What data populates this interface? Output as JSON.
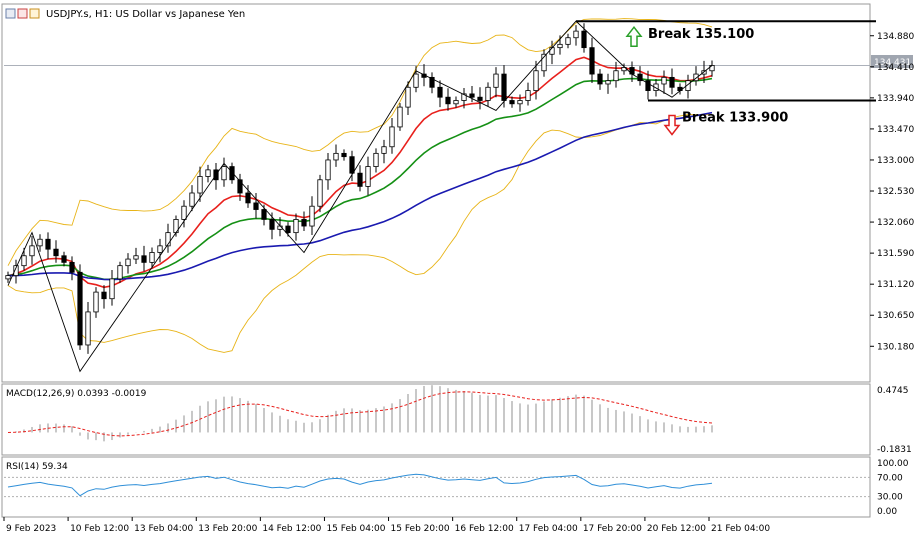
{
  "header": {
    "symbol_line": "USDJPY.s, H1: US Dollar vs Japanese Yen"
  },
  "colors": {
    "bull": "#000000",
    "bear": "#000000",
    "ma_fast": "#e8201c",
    "ma_mid": "#159015",
    "ma_slow": "#1a1ab0",
    "bollinger": "#e8b418",
    "zigzag": "#000000",
    "macd_hist": "#b0b0b0",
    "macd_signal": "#e8201c",
    "rsi_line": "#2f8fd8",
    "arrow_up": "#2aa02a",
    "arrow_down": "#e02020",
    "price_tag_bg": "#a0a6b0"
  },
  "chart_data": [
    {
      "name": "main",
      "type": "candlestick",
      "symbol": "USDJPY.s",
      "timeframe": "H1",
      "ylim": [
        129.7,
        135.3
      ],
      "y_ticks": [
        "134.880",
        "134.410",
        "133.940",
        "133.470",
        "133.000",
        "132.530",
        "132.060",
        "131.590",
        "131.120",
        "130.650",
        "130.180"
      ],
      "y_tick_values": [
        134.88,
        134.41,
        133.94,
        133.47,
        133.0,
        132.53,
        132.06,
        131.59,
        131.12,
        130.65,
        130.18
      ],
      "x_labels": [
        "9 Feb 2023",
        "10 Feb 12:00",
        "13 Feb 04:00",
        "13 Feb 20:00",
        "14 Feb 12:00",
        "15 Feb 04:00",
        "15 Feb 20:00",
        "16 Feb 12:00",
        "17 Feb 04:00",
        "17 Feb 20:00",
        "20 Feb 12:00",
        "21 Feb 04:00"
      ],
      "current_price": "134.431",
      "closes": [
        131.25,
        131.4,
        131.55,
        131.7,
        131.8,
        131.65,
        131.55,
        131.45,
        131.3,
        130.2,
        130.7,
        131.0,
        130.9,
        131.2,
        131.4,
        131.5,
        131.55,
        131.45,
        131.6,
        131.7,
        131.9,
        132.1,
        132.3,
        132.5,
        132.75,
        132.85,
        132.7,
        132.9,
        132.7,
        132.5,
        132.35,
        132.25,
        132.1,
        131.95,
        132.0,
        131.9,
        132.1,
        132.0,
        132.3,
        132.7,
        133.0,
        133.1,
        133.05,
        132.8,
        132.6,
        132.9,
        133.1,
        133.2,
        133.5,
        133.8,
        134.1,
        134.3,
        134.25,
        134.1,
        133.95,
        133.85,
        133.9,
        134.0,
        133.95,
        133.9,
        134.1,
        134.3,
        133.9,
        133.85,
        133.9,
        134.05,
        134.35,
        134.6,
        134.7,
        134.75,
        134.85,
        134.95,
        134.7,
        134.3,
        134.15,
        134.2,
        134.35,
        134.4,
        134.3,
        134.2,
        134.05,
        134.15,
        134.25,
        134.1,
        134.05,
        134.2,
        134.3,
        134.35,
        134.431
      ],
      "zigzag_points": [
        [
          0,
          131.1
        ],
        [
          3,
          131.9
        ],
        [
          9,
          129.8
        ],
        [
          27,
          132.95
        ],
        [
          37,
          131.6
        ],
        [
          51,
          134.35
        ],
        [
          61,
          133.75
        ],
        [
          71,
          135.1
        ],
        [
          78,
          134.3
        ],
        [
          83,
          133.95
        ],
        [
          88,
          134.43
        ]
      ],
      "levels": [
        {
          "label": "Break 135.100",
          "value": 135.1,
          "arrow": "up"
        },
        {
          "label": "Break 133.900",
          "value": 133.9,
          "arrow": "down"
        }
      ]
    },
    {
      "name": "macd",
      "type": "bar",
      "label": "MACD(12,26,9) 0.0393 -0.0019",
      "y_ticks": [
        "0.4745",
        "-0.1831"
      ],
      "y_tick_values": [
        0.4745,
        -0.1831
      ],
      "ylim": [
        -0.23,
        0.52
      ]
    },
    {
      "name": "rsi",
      "type": "line",
      "label": "RSI(14) 59.34",
      "y_ticks": [
        "100.00",
        "70.00",
        "30.00",
        "0.00"
      ],
      "y_tick_values": [
        100,
        70,
        30,
        0
      ],
      "ylim": [
        -8,
        108
      ]
    }
  ]
}
